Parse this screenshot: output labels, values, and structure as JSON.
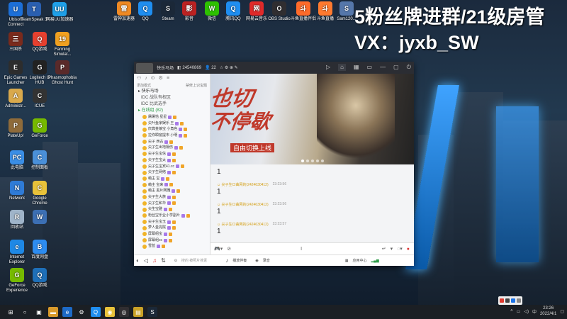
{
  "banner": {
    "line1": "5粉丝牌进群/21级房管",
    "line2": "VX：jyxb_SW"
  },
  "desktop_left": [
    {
      "label": "Ubisoft Connect",
      "color": "#1c6fd8",
      "glyph": "U"
    },
    {
      "label": "TeamSpeak 3",
      "color": "#2a5fb0",
      "glyph": "T"
    },
    {
      "label": "网易UU加速器",
      "color": "#1fa0e8",
      "glyph": "UU"
    },
    {
      "label": "三国杀",
      "color": "#7a2a1c",
      "glyph": "三"
    },
    {
      "label": "QQ游戏",
      "color": "#e6402f",
      "glyph": "Q"
    },
    {
      "label": "Farming Simulat...",
      "color": "#f0a020",
      "glyph": "19"
    },
    {
      "label": "Epic Games Launcher",
      "color": "#2d2d2d",
      "glyph": "E"
    },
    {
      "label": "Logitech G HUB",
      "color": "#222",
      "glyph": "G"
    },
    {
      "label": "Phasmophobia Ghost Hunt",
      "color": "#5a2a2a",
      "glyph": "P"
    },
    {
      "label": "Administr...",
      "color": "#d9a94c",
      "glyph": "A"
    },
    {
      "label": "ICUE",
      "color": "#333",
      "glyph": "C"
    },
    {
      "label": "PlateUp!",
      "color": "#8f6b3a",
      "glyph": "P"
    },
    {
      "label": "GeForce",
      "color": "#76b900",
      "glyph": "G"
    },
    {
      "label": "此电脑",
      "color": "#3a8ee6",
      "glyph": "PC"
    },
    {
      "label": "控制面板",
      "color": "#4a90d9",
      "glyph": "C"
    },
    {
      "label": "Network",
      "color": "#2f7bd6",
      "glyph": "N"
    },
    {
      "label": "Google Chrome",
      "color": "#e8c23a",
      "glyph": "C"
    },
    {
      "label": "回收站",
      "color": "#9fb4c9",
      "glyph": "R"
    },
    {
      "label": "",
      "color": "#3c6fb3",
      "glyph": "W"
    },
    {
      "label": "Internet Explorer",
      "color": "#1e88e5",
      "glyph": "e"
    },
    {
      "label": "百度网盘",
      "color": "#2d8cf0",
      "glyph": "B"
    },
    {
      "label": "GeForce Experience",
      "color": "#76b900",
      "glyph": "G"
    },
    {
      "label": "QQ游戏",
      "color": "#1e6fb8",
      "glyph": "Q"
    }
  ],
  "desktop_top": [
    {
      "label": "雷神加速器",
      "color": "#f08a24",
      "glyph": "雷"
    },
    {
      "label": "QQ",
      "color": "#1f8ef0",
      "glyph": "Q"
    },
    {
      "label": "Steam",
      "color": "#1b2838",
      "glyph": "S"
    },
    {
      "label": "影音",
      "color": "#b22",
      "glyph": "影"
    },
    {
      "label": "微信",
      "color": "#2dc100",
      "glyph": "W"
    },
    {
      "label": "腾讯QQ",
      "color": "#1f8ef0",
      "glyph": "Q"
    },
    {
      "label": "网易云音乐",
      "color": "#e02a2a",
      "glyph": "网"
    },
    {
      "label": "OBS Studio",
      "color": "#302e31",
      "glyph": "O"
    },
    {
      "label": "斗鱼直播伴侣",
      "color": "#ff6b2a",
      "glyph": "斗"
    },
    {
      "label": "斗鱼直播",
      "color": "#ff7a2f",
      "glyph": "斗"
    },
    {
      "label": "Sam120...",
      "color": "#5577aa",
      "glyph": "S"
    }
  ],
  "window": {
    "title": "快乐马场",
    "room_id": "24540869",
    "users": "22",
    "left_tabs": [
      "添加模式",
      "禁修上识宝题"
    ],
    "groups": [
      {
        "label": "▸ 快乐马场",
        "class": ""
      },
      {
        "label": "IDC 战队有权区",
        "class": "sub"
      },
      {
        "label": "IDC 比武选手",
        "class": "sub"
      },
      {
        "label": "▸ 在线组 (82)",
        "class": "green"
      }
    ],
    "members": [
      "屠屠恰 星星",
      "尖叶鱼家娱乐 王",
      "庆典金娘宝 小角色",
      "拉你瞬窗提市 小明",
      "尖子 西古",
      "尖子生出地隔伤",
      "尖子生宝信",
      "尖子生宝太",
      "尖子生宝宾41.cc",
      "尖子生网络",
      "萌主 宝",
      "萌主 宝来",
      "萌主 黑片网雅",
      "尖子生大族",
      "尖子生和华",
      "尖生宝雅",
      "粉丝宝乐业小学副片",
      "尖子生宝玉",
      "萝人金完院",
      "屏幕组宝",
      "屏幕组cc",
      "雪蓝"
    ],
    "chat": [
      {
        "name": "尖子生CI曲网的(2424630412)",
        "time": "23:23:56",
        "text": "1"
      },
      {
        "name": "尖子生CI曲网的(2424630412)",
        "time": "23:23:56",
        "text": "1"
      },
      {
        "name": "尖子生CI曲网的(2424630412)",
        "time": "23:23:57",
        "text": "1"
      }
    ],
    "first_line": "1",
    "poster": {
      "line1": "也切",
      "line2": "不停歇",
      "caption": "自由切换上线"
    },
    "bottom": {
      "search_placeholder": "搜的 被照片搜素",
      "music": "播放伴奏",
      "video": "录音",
      "app": "应用中心"
    }
  },
  "clock": {
    "time": "23:26",
    "date": "2022/4/1"
  }
}
